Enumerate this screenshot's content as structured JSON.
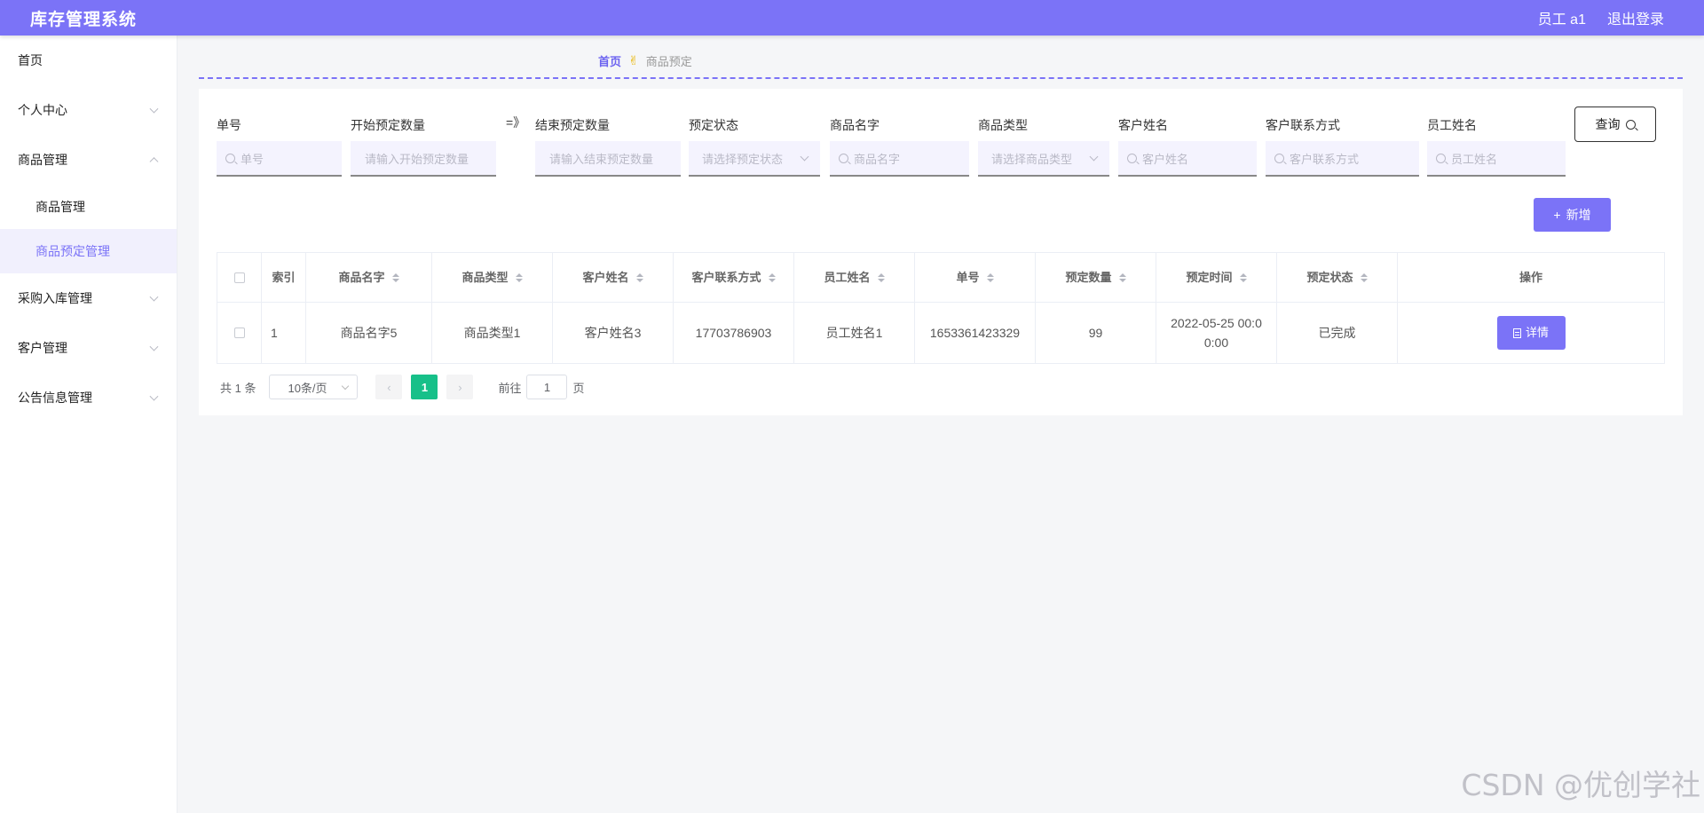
{
  "app": {
    "title": "库存管理系统"
  },
  "topbar": {
    "user": "员工 a1",
    "logout": "退出登录"
  },
  "sidebar": {
    "items": [
      {
        "label": "首页"
      },
      {
        "label": "个人中心"
      },
      {
        "label": "商品管理"
      },
      {
        "label": "商品管理"
      },
      {
        "label": "商品预定管理"
      },
      {
        "label": "采购入库管理"
      },
      {
        "label": "客户管理"
      },
      {
        "label": "公告信息管理"
      }
    ]
  },
  "breadcrumb": {
    "home": "首页",
    "icon": "✌",
    "current": "商品预定"
  },
  "filters": {
    "order_no": {
      "label": "单号",
      "placeholder": "单号"
    },
    "qty_start": {
      "label": "开始预定数量",
      "placeholder": "请输入开始预定数量"
    },
    "range_sep": "=》",
    "qty_end": {
      "label": "结束预定数量",
      "placeholder": "请输入结束预定数量"
    },
    "status": {
      "label": "预定状态",
      "placeholder": "请选择预定状态"
    },
    "goods_name": {
      "label": "商品名字",
      "placeholder": "商品名字"
    },
    "goods_type": {
      "label": "商品类型",
      "placeholder": "请选择商品类型"
    },
    "customer_name": {
      "label": "客户姓名",
      "placeholder": "客户姓名"
    },
    "customer_contact": {
      "label": "客户联系方式",
      "placeholder": "客户联系方式"
    },
    "staff_name": {
      "label": "员工姓名",
      "placeholder": "员工姓名"
    },
    "query_label": "查询"
  },
  "actions": {
    "add_label": "新增"
  },
  "table": {
    "headers": {
      "index": "索引",
      "goods_name": "商品名字",
      "goods_type": "商品类型",
      "customer_name": "客户姓名",
      "customer_contact": "客户联系方式",
      "staff_name": "员工姓名",
      "order_no": "单号",
      "qty": "预定数量",
      "time": "预定时间",
      "status": "预定状态",
      "ops": "操作"
    },
    "rows": [
      {
        "index": "1",
        "goods_name": "商品名字5",
        "goods_type": "商品类型1",
        "customer_name": "客户姓名3",
        "customer_contact": "17703786903",
        "staff_name": "员工姓名1",
        "order_no": "1653361423329",
        "qty": "99",
        "time": "2022-05-25 00:00:00",
        "status": "已完成",
        "detail_label": "详情"
      }
    ]
  },
  "pagination": {
    "total": "共 1 条",
    "page_size": "10条/页",
    "prev": "‹",
    "current": "1",
    "next": "›",
    "goto_prefix": "前往",
    "goto_value": "1",
    "goto_suffix": "页"
  },
  "watermark": "CSDN @优创学社",
  "colors": {
    "accent": "#7b73f7",
    "page_current": "#17c089"
  }
}
